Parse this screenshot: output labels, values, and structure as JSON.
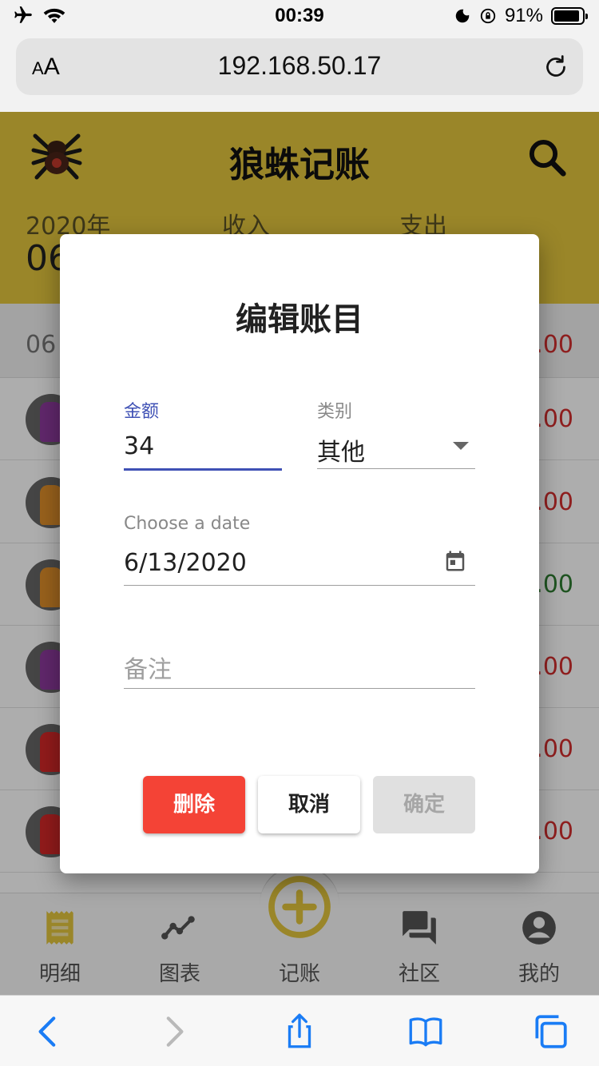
{
  "status_bar": {
    "time": "00:39",
    "battery": "91%",
    "battery_level": 0.91
  },
  "browser": {
    "text_size_small": "A",
    "text_size_large": "A",
    "url": "192.168.50.17"
  },
  "app": {
    "title": "狼蛛记账",
    "summary": {
      "year": "2020年",
      "month_partial": "06",
      "income_label": "收入",
      "expense_label": "支出"
    },
    "day_header": {
      "date_partial": "06 /",
      "total_partial": ".00"
    },
    "entries": [
      {
        "amount_partial": ".00",
        "color": "#d32f2f",
        "avatar_color": "#8e3a9e"
      },
      {
        "amount_partial": ".00",
        "color": "#d32f2f",
        "avatar_color": "#e0902a"
      },
      {
        "amount_partial": ".00",
        "color": "#2e7d32",
        "avatar_color": "#e0902a"
      },
      {
        "amount_partial": ".00",
        "color": "#d32f2f",
        "avatar_color": "#8e3a9e"
      },
      {
        "amount_partial": ".00",
        "color": "#d32f2f",
        "avatar_color": "#d62828"
      },
      {
        "amount_partial": ".00",
        "color": "#d32f2f",
        "avatar_color": "#d62828"
      }
    ],
    "nav": [
      {
        "label": "明细",
        "icon": "receipt-icon"
      },
      {
        "label": "图表",
        "icon": "line-chart-icon"
      },
      {
        "label": "记账",
        "icon": "add-circle-icon"
      },
      {
        "label": "社区",
        "icon": "forum-icon"
      },
      {
        "label": "我的",
        "icon": "account-circle-icon"
      }
    ],
    "accent_color": "#e3c63d"
  },
  "dialog": {
    "title": "编辑账目",
    "amount_label": "金额",
    "amount_value": "34",
    "category_label": "类别",
    "category_value": "其他",
    "date_label": "Choose a date",
    "date_value": "6/13/2020",
    "note_placeholder": "备注",
    "delete_label": "删除",
    "cancel_label": "取消",
    "confirm_label": "确定"
  }
}
